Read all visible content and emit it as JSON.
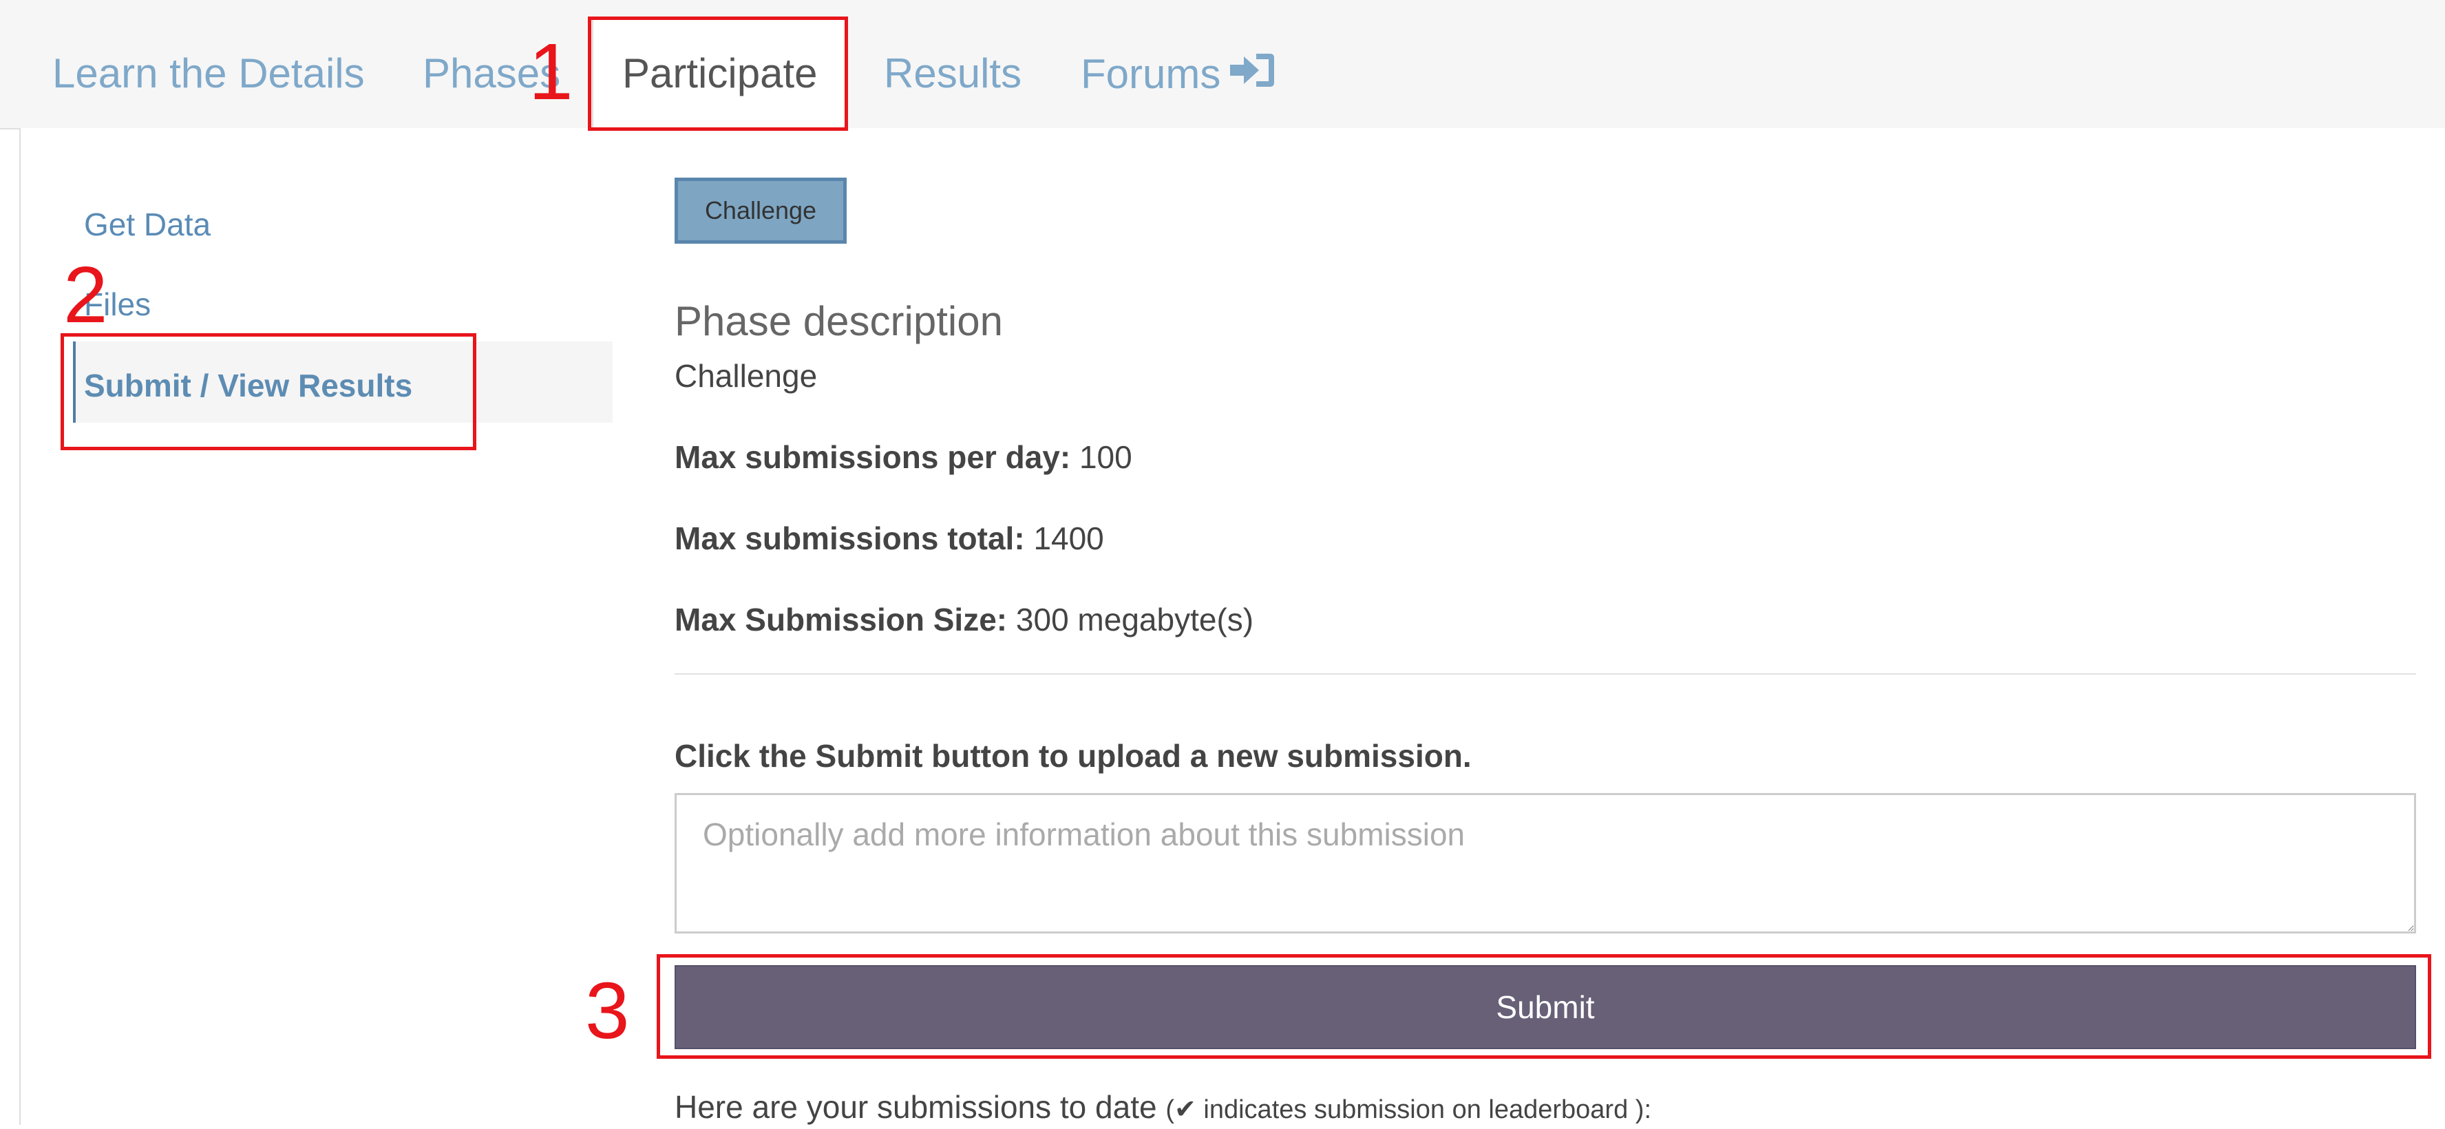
{
  "tabs": [
    {
      "label": "Learn the Details",
      "active": false
    },
    {
      "label": "Phases",
      "active": false
    },
    {
      "label": "Participate",
      "active": true
    },
    {
      "label": "Results",
      "active": false
    },
    {
      "label": "Forums",
      "active": false,
      "icon": "sign-in-icon"
    }
  ],
  "sidebar": {
    "items": [
      {
        "label": "Get Data",
        "active": false
      },
      {
        "label": "Files",
        "active": false
      },
      {
        "label": "Submit / View Results",
        "active": true
      }
    ]
  },
  "phase": {
    "button_label": "Challenge",
    "description_heading": "Phase description",
    "description": "Challenge"
  },
  "limits": {
    "per_day_label": "Max submissions per day:",
    "per_day_value": "100",
    "total_label": "Max submissions total:",
    "total_value": "1400",
    "size_label": "Max Submission Size:",
    "size_value": "300 megabyte(s)"
  },
  "submission": {
    "instruction": "Click the Submit button to upload a new submission.",
    "placeholder": "Optionally add more information about this submission",
    "value": "",
    "submit_label": "Submit",
    "to_date_text": "Here are your submissions to date",
    "leaderboard_note": "indicates submission on leaderboard",
    "leaderboard_open": "(",
    "leaderboard_close": "):"
  },
  "annotations": {
    "step1": "1",
    "step2": "2",
    "step3": "3"
  },
  "colors": {
    "link": "#7fa8c9",
    "active_side": "#5d8cb3",
    "phase_button": "#7ea6c3",
    "submit_button": "#676077",
    "annotation": "#e8151b"
  }
}
